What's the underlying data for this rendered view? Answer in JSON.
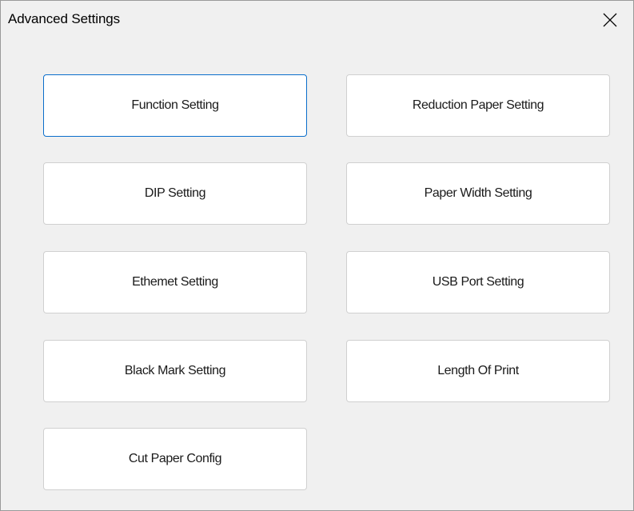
{
  "window": {
    "title": "Advanced Settings",
    "close_icon": "close-icon"
  },
  "buttons": {
    "function_setting": "Function Setting",
    "reduction_paper_setting": "Reduction Paper Setting",
    "dip_setting": "DIP Setting",
    "paper_width_setting": "Paper Width Setting",
    "ethernet_setting": "Ethemet Setting",
    "usb_port_setting": "USB Port Setting",
    "black_mark_setting": "Black Mark Setting",
    "length_of_print": "Length Of Print",
    "cut_paper_config": "Cut Paper Config"
  },
  "colors": {
    "focus_border": "#0a6ecb",
    "window_background": "#f0f0f0",
    "button_background": "#ffffff"
  }
}
